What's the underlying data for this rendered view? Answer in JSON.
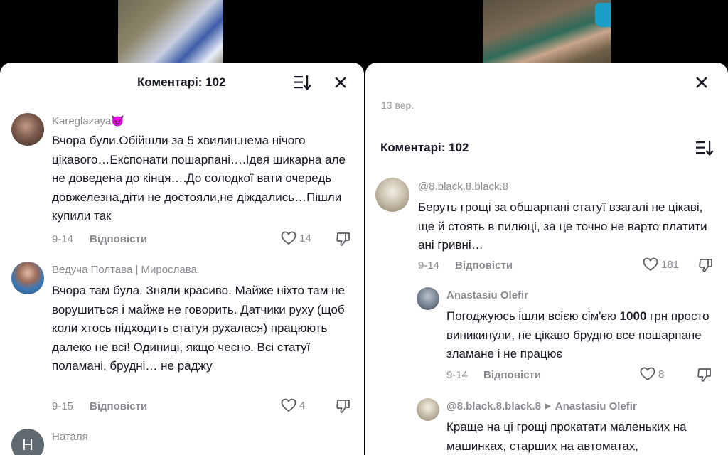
{
  "left": {
    "header": {
      "title": "Коментарі: 102"
    },
    "comments": [
      {
        "name": "Kareglazaya😈",
        "text": "Вчора були.Обійшли за 5 хвилин.нема нічого цікавого…Експонати пошарпані….Ідея шикарна але не доведена до кінця….До солодкої вати очередь довжелезна,діти не достояли,не діждались…Пішли купили так",
        "date": "9-14",
        "reply": "Відповісти",
        "likes": "14"
      },
      {
        "name": "Ведуча Полтава | Мирослава",
        "text": "Вчора там була. Зняли красиво. Майже ніхто там не ворушиться і майже не говорить. Датчики руху (щоб коли хтось підходить статуя рухалася) працюють далеко не всі! Одиниці, якщо чесно. Всі статуї поламані, брудні… не раджу",
        "date": "9-15",
        "reply": "Відповісти",
        "likes": "4"
      },
      {
        "name": "Наталя",
        "avatar_letter": "Н"
      }
    ]
  },
  "right": {
    "top_date": "13 вер.",
    "header": {
      "title": "Коментарі: 102"
    },
    "comments": [
      {
        "name": "@8.black.8.black.8",
        "text": "Беруть грощі за обшарпані статуї взагалі не цікаві, ще й стоять в пилюці, за це точно не варто платити ані гривні…",
        "date": "9-14",
        "reply": "Відповісти",
        "likes": "181"
      },
      {
        "name": "Anastasiu Olefir",
        "text_before": "Погоджуюсь ішли всією сім'єю ",
        "text_bold": "1000",
        "text_after": " грн просто виникинули, не цікаво брудно все пошарпане зламане і не працює",
        "date": "9-14",
        "reply": "Відповісти",
        "likes": "8"
      },
      {
        "name": "@8.black.8.black.8",
        "reply_to": "Anastasiu Olefir",
        "text": "Краще на ці грощі прокатати маленьких на машинках, старших на автоматах,"
      }
    ]
  },
  "colors": {
    "text": "#161823",
    "muted": "#8a8b91",
    "sheet": "#ffffff",
    "backdrop": "#000000"
  }
}
